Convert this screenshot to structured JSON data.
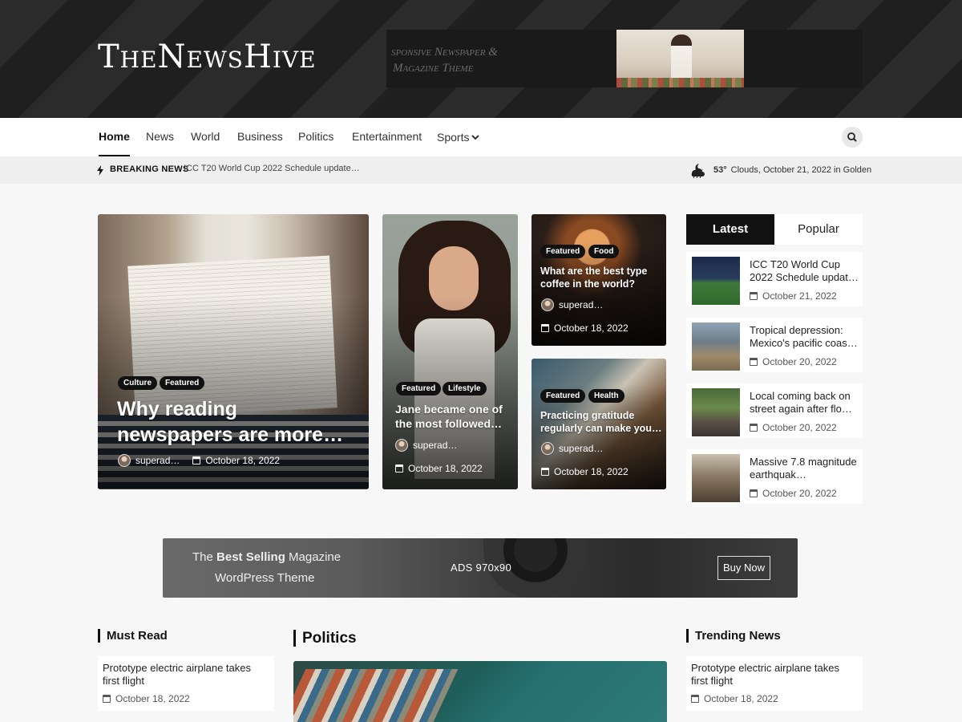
{
  "header": {
    "logo": "TheNewsHive",
    "ad_text_line1": "sponsive Newspaper &",
    "ad_text_line2": "Magazine Theme"
  },
  "nav": {
    "items": [
      {
        "label": "Home",
        "active": true
      },
      {
        "label": "News"
      },
      {
        "label": "World"
      },
      {
        "label": "Business"
      },
      {
        "label": "Politics"
      },
      {
        "label": "Entertainment"
      },
      {
        "label": "Sports"
      }
    ],
    "search_icon": "search-icon",
    "sports_icon": "chevron-down-icon"
  },
  "breaking": {
    "label": "BREAKING NEWS",
    "text": "ICC T20 World Cup 2022 Schedule update…",
    "icon": "lightning-icon"
  },
  "weather": {
    "temp": "53°",
    "desc": "Clouds, October 21, 2022 in Golden",
    "icon": "cloud-moon-icon"
  },
  "featured": [
    {
      "badges": [
        "Culture",
        "Featured"
      ],
      "title": "Why reading newspapers are more…",
      "author": "superad…",
      "date": "October 18, 2022"
    },
    {
      "badges": [
        "Featured",
        "Lifestyle"
      ],
      "title": "Jane became one of the most followed…",
      "author": "superad…",
      "date": "October 18, 2022"
    },
    {
      "badges": [
        "Featured",
        "Food"
      ],
      "title": "What are the best type coffee in the world?",
      "author": "superad…",
      "date": "October 18, 2022"
    },
    {
      "badges": [
        "Featured",
        "Health"
      ],
      "title": "Practicing gratitude regularly can make you…",
      "author": "superad…",
      "date": "October 18, 2022"
    }
  ],
  "sidebar": {
    "tabs": [
      {
        "label": "Latest",
        "active": true
      },
      {
        "label": "Popular"
      }
    ],
    "items": [
      {
        "title": "ICC T20 World Cup 2022 Schedule updat…",
        "date": "October 21, 2022"
      },
      {
        "title": "Tropical depression: Mexico's pacific coas…",
        "date": "October 20, 2022"
      },
      {
        "title": "Local coming back on street again after flo…",
        "date": "October 20, 2022"
      },
      {
        "title": "Massive 7.8 magnitude earthquak…",
        "date": "October 20, 2022"
      }
    ]
  },
  "ad": {
    "line1_pre": "The ",
    "line1_bold": "Best Selling",
    "line1_post": " Magazine",
    "line2": "WordPress Theme",
    "mid": "ADS 970x90",
    "button": "Buy Now"
  },
  "bottom": {
    "must_read": {
      "title": "Must Read",
      "item": {
        "title": "Prototype electric airplane takes first flight",
        "date": "October 18, 2022"
      }
    },
    "politics": {
      "title": "Politics"
    },
    "trending": {
      "title": "Trending News",
      "item": {
        "title": "Prototype electric airplane takes first flight",
        "date": "October 18, 2022"
      }
    }
  },
  "colors": {
    "accent": "#111111",
    "header_bg": "#2b2b2b",
    "breaking_bg": "#efefef"
  }
}
